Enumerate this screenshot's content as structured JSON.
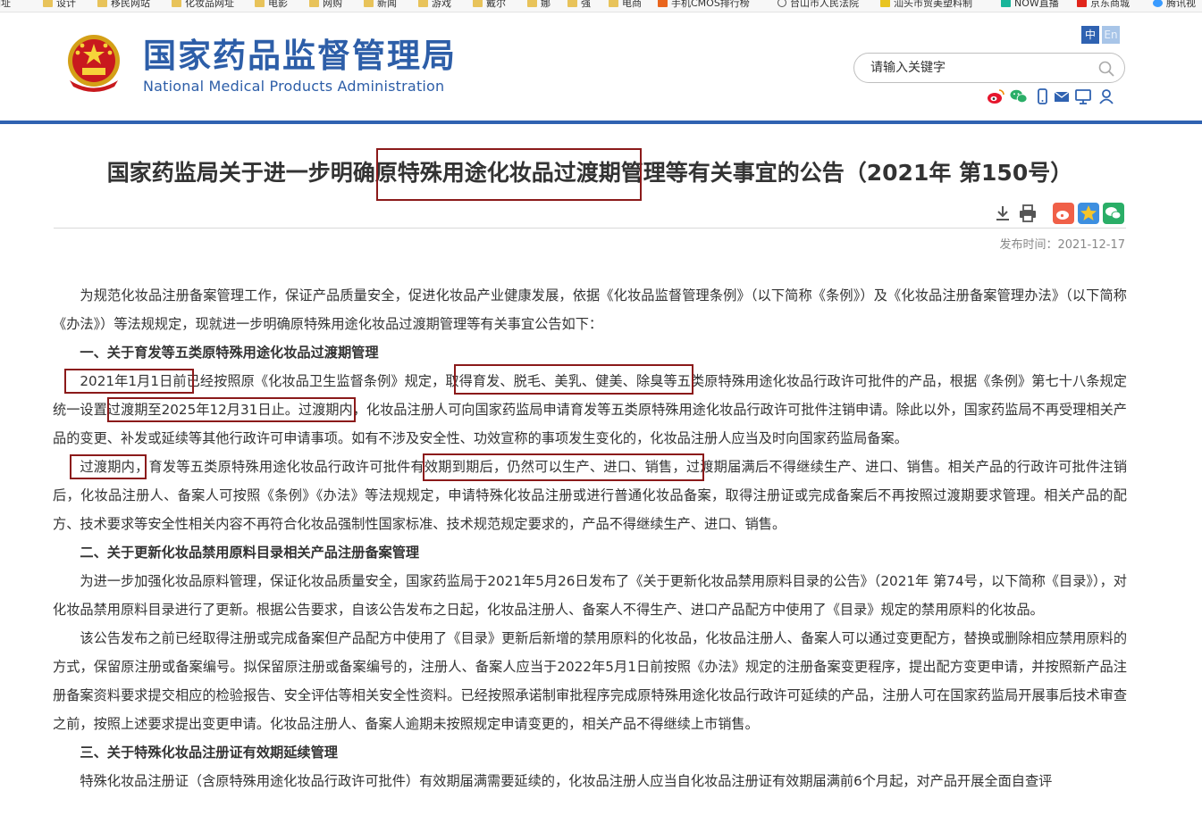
{
  "bookmarks": [
    {
      "label": "网址",
      "icon": "folder-icon"
    },
    {
      "label": "设计",
      "icon": "folder-icon"
    },
    {
      "label": "移民网站",
      "icon": "folder-icon"
    },
    {
      "label": "化妆品网址",
      "icon": "folder-icon"
    },
    {
      "label": "电影",
      "icon": "folder-icon"
    },
    {
      "label": "网购",
      "icon": "folder-icon"
    },
    {
      "label": "新闻",
      "icon": "folder-icon"
    },
    {
      "label": "游戏",
      "icon": "folder-icon"
    },
    {
      "label": "戴尔",
      "icon": "folder-icon"
    },
    {
      "label": "娜",
      "icon": "folder-icon"
    },
    {
      "label": "强",
      "icon": "folder-icon"
    },
    {
      "label": "电商",
      "icon": "folder-icon"
    },
    {
      "label": "手机CMOS排行榜",
      "icon": "orange-site-icon"
    },
    {
      "label": "台山市人民法院",
      "icon": "globe-icon"
    },
    {
      "label": "汕头市贸美塑料制",
      "icon": "yellow-site-icon"
    },
    {
      "label": "NOW直播",
      "icon": "now-live-icon"
    },
    {
      "label": "京东商城",
      "icon": "jd-icon"
    },
    {
      "label": "腾讯视",
      "icon": "tencent-icon"
    }
  ],
  "header": {
    "site_title": "国家药品监督管理局",
    "site_subtitle": "National Medical Products Administration",
    "lang_zh": "中",
    "lang_en": "En",
    "search_placeholder": "请输入关键字",
    "accent_color": "#2f62b1"
  },
  "article": {
    "title": "国家药监局关于进一步明确原特殊用途化妆品过渡期管理等有关事宜的公告（2021年 第150号）",
    "pubdate": "发布时间：2021-12-17",
    "intro": "为规范化妆品注册备案管理工作，保证产品质量安全，促进化妆品产业健康发展，依据《化妆品监督管理条例》（以下简称《条例》）及《化妆品注册备案管理办法》（以下简称《办法》）等法规规定，现就进一步明确原特殊用途化妆品过渡期管理等有关事宜公告如下：",
    "s1_heading": "一、关于育发等五类原特殊用途化妆品过渡期管理",
    "s1_p1": "2021年1月1日前已经按照原《化妆品卫生监督条例》规定，取得育发、脱毛、美乳、健美、除臭等五类原特殊用途化妆品行政许可批件的产品，根据《条例》第七十八条规定统一设置过渡期至2025年12月31日止。过渡期内，化妆品注册人可向国家药监局申请育发等五类原特殊用途化妆品行政许可批件注销申请。除此以外，国家药监局不再受理相关产品的变更、补发或延续等其他行政许可申请事项。如有不涉及安全性、功效宣称的事项发生变化的，化妆品注册人应当及时向国家药监局备案。",
    "s1_p2": "过渡期内，育发等五类原特殊用途化妆品行政许可批件有效期到期后，仍然可以生产、进口、销售，过渡期届满后不得继续生产、进口、销售。相关产品的行政许可批件注销后，化妆品注册人、备案人可按照《条例》《办法》等法规规定，申请特殊化妆品注册或进行普通化妆品备案，取得注册证或完成备案后不再按照过渡期要求管理。相关产品的配方、技术要求等安全性相关内容不再符合化妆品强制性国家标准、技术规范规定要求的，产品不得继续生产、进口、销售。",
    "s2_heading": "二、关于更新化妆品禁用原料目录相关产品注册备案管理",
    "s2_p1": "为进一步加强化妆品原料管理，保证化妆品质量安全，国家药监局于2021年5月26日发布了《关于更新化妆品禁用原料目录的公告》（2021年 第74号，以下简称《目录》），对化妆品禁用原料目录进行了更新。根据公告要求，自该公告发布之日起，化妆品注册人、备案人不得生产、进口产品配方中使用了《目录》规定的禁用原料的化妆品。",
    "s2_p2": "该公告发布之前已经取得注册或完成备案但产品配方中使用了《目录》更新后新增的禁用原料的化妆品，化妆品注册人、备案人可以通过变更配方，替换或删除相应禁用原料的方式，保留原注册或备案编号。拟保留原注册或备案编号的，注册人、备案人应当于2022年5月1日前按照《办法》规定的注册备案变更程序，提出配方变更申请，并按照新产品注册备案资料要求提交相应的检验报告、安全评估等相关安全性资料。已经按照承诺制审批程序完成原特殊用途化妆品行政许可延续的产品，注册人可在国家药监局开展事后技术审查之前，按照上述要求提出变更申请。化妆品注册人、备案人逾期未按照规定申请变更的，相关产品不得继续上市销售。",
    "s3_heading": "三、关于特殊化妆品注册证有效期延续管理",
    "s3_p1": "特殊化妆品注册证（含原特殊用途化妆品行政许可批件）有效期届满需要延续的，化妆品注册人应当自化妆品注册证有效期届满前6个月起，对产品开展全面自查评"
  }
}
